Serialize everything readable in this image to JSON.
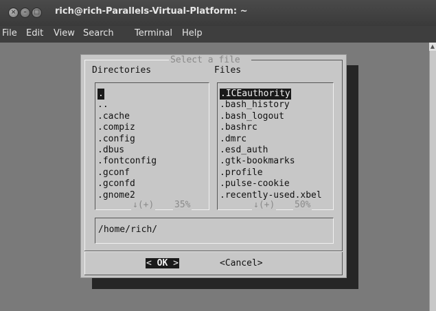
{
  "window": {
    "title": "rich@rich-Parallels-Virtual-Platform: ~",
    "close_glyph": "×",
    "min_glyph": "–",
    "max_glyph": "□"
  },
  "menubar": {
    "items": [
      "File",
      "Edit",
      "View",
      "Search",
      "Terminal",
      "Help"
    ]
  },
  "dialog": {
    "title": "Select a file",
    "directories_label": "Directories",
    "files_label": "Files",
    "directories": [
      ".",
      "..",
      ".cache",
      ".compiz",
      ".config",
      ".dbus",
      ".fontconfig",
      ".gconf",
      ".gconfd",
      ".gnome2"
    ],
    "directories_selected": ".",
    "directories_scroll": "↓(+)",
    "directories_percent": "35%",
    "files": [
      ".ICEauthority",
      ".bash_history",
      ".bash_logout",
      ".bashrc",
      ".dmrc",
      ".esd_auth",
      ".gtk-bookmarks",
      ".profile",
      ".pulse-cookie",
      ".recently-used.xbel"
    ],
    "files_selected": ".ICEauthority",
    "files_scroll": "↓(+)",
    "files_percent": "50%",
    "path_value": "/home/rich/",
    "ok_left": "<",
    "ok_label": "OK",
    "ok_right": ">",
    "cancel_label": "<Cancel>"
  }
}
